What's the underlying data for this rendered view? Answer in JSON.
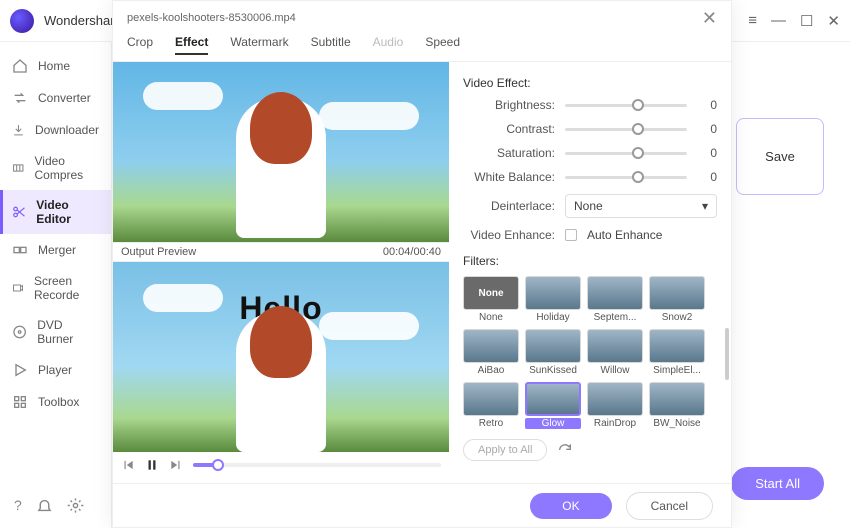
{
  "titlebar": {
    "brand": "Wondershare"
  },
  "sidebar": {
    "items": [
      {
        "label": "Home"
      },
      {
        "label": "Converter"
      },
      {
        "label": "Downloader"
      },
      {
        "label": "Video Compres"
      },
      {
        "label": "Video Editor"
      },
      {
        "label": "Merger"
      },
      {
        "label": "Screen Recorde"
      },
      {
        "label": "DVD Burner"
      },
      {
        "label": "Player"
      },
      {
        "label": "Toolbox"
      }
    ],
    "active_index": 4
  },
  "main": {
    "save": "Save",
    "start_all": "Start All"
  },
  "modal": {
    "filename": "pexels-koolshooters-8530006.mp4",
    "tabs": [
      "Crop",
      "Effect",
      "Watermark",
      "Subtitle",
      "Audio",
      "Speed"
    ],
    "active_tab": 1,
    "disabled_tab": 4,
    "output_preview_label": "Output Preview",
    "time": "00:04/00:40",
    "overlay_text": "Hello",
    "video_effect_title": "Video Effect:",
    "sliders": [
      {
        "label": "Brightness:",
        "value": 0,
        "pos": 60
      },
      {
        "label": "Contrast:",
        "value": 0,
        "pos": 60
      },
      {
        "label": "Saturation:",
        "value": 0,
        "pos": 60
      },
      {
        "label": "White Balance:",
        "value": 0,
        "pos": 60
      }
    ],
    "deinterlace_label": "Deinterlace:",
    "deinterlace_value": "None",
    "video_enhance_label": "Video Enhance:",
    "auto_enhance_label": "Auto Enhance",
    "filters_title": "Filters:",
    "filters": [
      {
        "name": "None",
        "thumb_text": "None"
      },
      {
        "name": "Holiday"
      },
      {
        "name": "Septem..."
      },
      {
        "name": "Snow2"
      },
      {
        "name": "AiBao"
      },
      {
        "name": "SunKissed"
      },
      {
        "name": "Willow"
      },
      {
        "name": "SimpleEl..."
      },
      {
        "name": "Retro"
      },
      {
        "name": "Glow"
      },
      {
        "name": "RainDrop"
      },
      {
        "name": "BW_Noise"
      }
    ],
    "selected_filter": 9,
    "apply_to_all": "Apply to All",
    "ok": "OK",
    "cancel": "Cancel"
  },
  "colors": {
    "accent": "#8e78ff"
  }
}
